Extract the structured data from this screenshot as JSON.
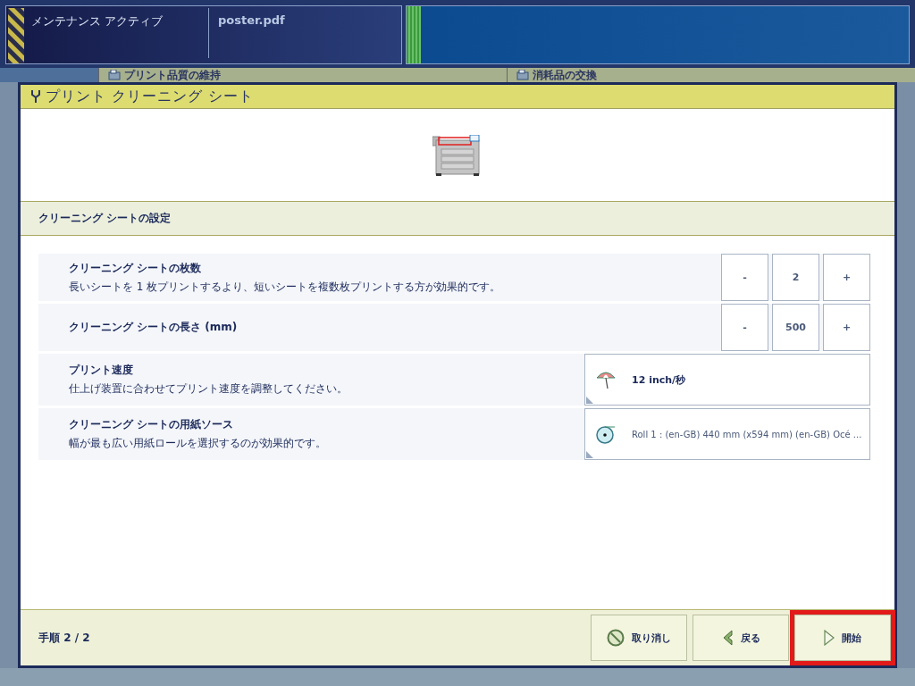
{
  "status_bar": {
    "mode": "メンテナンス アクティブ",
    "job": "poster.pdf"
  },
  "background_tabs": [
    {
      "label": "プリント品質の維持"
    },
    {
      "label": "消耗品の交換"
    }
  ],
  "dialog": {
    "title": "プリント クリーニング シート",
    "section": "クリーニング シートの設定",
    "settings": [
      {
        "kind": "stepper",
        "label": "クリーニング シートの枚数",
        "description": "長いシートを 1 枚プリントするより、短いシートを複数枚プリントする方が効果的です。",
        "decrement": "-",
        "value": "2",
        "increment": "+"
      },
      {
        "kind": "stepper",
        "label": "クリーニング シートの長さ (mm)",
        "decrement": "-",
        "value": "500",
        "increment": "+"
      },
      {
        "kind": "speed",
        "label": "プリント速度",
        "description": "仕上げ装置に合わせてプリント速度を調整してください。",
        "value": "12 inch/秒"
      },
      {
        "kind": "media",
        "label": "クリーニング シートの用紙ソース",
        "description": "幅が最も広い用紙ロールを選択するのが効果的です。",
        "value": "Roll 1 : (en-GB) 440 mm (x594 mm) (en-GB) Océ ..."
      }
    ],
    "step": "手順 2 / 2",
    "buttons": [
      {
        "kind": "cancel",
        "label": "取り消し",
        "highlighted": false
      },
      {
        "kind": "back",
        "label": "戻る",
        "highlighted": false
      },
      {
        "kind": "start",
        "label": "開始",
        "highlighted": true
      }
    ]
  }
}
